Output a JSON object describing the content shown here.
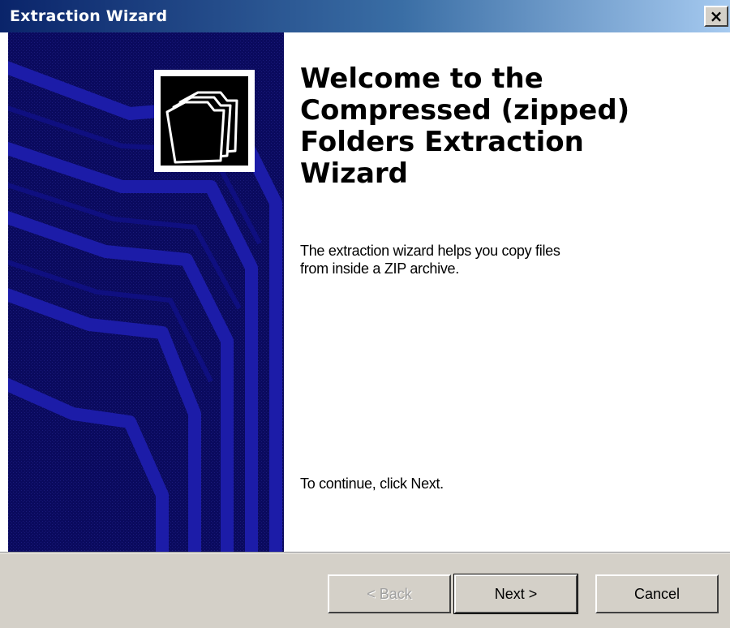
{
  "window": {
    "title": "Extraction Wizard",
    "close_glyph": "×"
  },
  "icons": {
    "close": "close-icon",
    "wizard_art": "folder-art-icon",
    "zip_folder": "zip-folder-icon"
  },
  "colors": {
    "titlebar_start": "#0a246a",
    "titlebar_end": "#a6caf0",
    "side_panel": "#0a0a5e",
    "dialog_face": "#d4d0c8"
  },
  "main": {
    "heading": {
      "line1": "Welcome to the",
      "line2": "Compressed (zipped)",
      "line3": "Folders Extraction",
      "line4": "Wizard"
    },
    "description": {
      "line1": "The extraction wizard helps you copy files",
      "line2": "from inside a ZIP archive."
    },
    "continue_text": "To continue, click Next."
  },
  "buttons": {
    "back": "< Back",
    "next": "Next >",
    "cancel": "Cancel"
  }
}
